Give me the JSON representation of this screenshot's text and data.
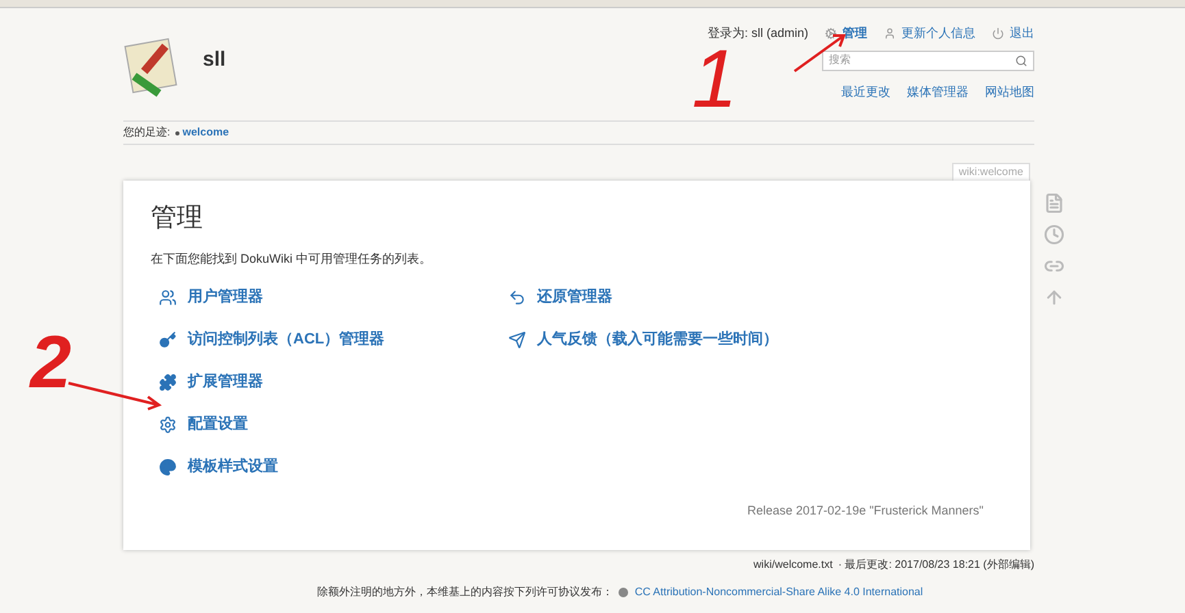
{
  "user_bar": {
    "logged_in_as": "登录为: sll (admin)",
    "links": [
      {
        "kind": "admin",
        "label": "管理",
        "selected": true
      },
      {
        "kind": "profile",
        "label": "更新个人信息",
        "selected": false
      },
      {
        "kind": "logout",
        "label": "退出",
        "selected": false
      }
    ]
  },
  "site": {
    "title": "sll"
  },
  "search": {
    "placeholder": "搜索"
  },
  "site_tools": [
    "最近更改",
    "媒体管理器",
    "网站地图"
  ],
  "breadcrumbs": {
    "label": "您的足迹:",
    "items": [
      "welcome"
    ]
  },
  "page": {
    "id": "wiki:welcome",
    "title": "管理",
    "intro": "在下面您能找到 DokuWiki 中可用管理任务的列表。",
    "columns": [
      [
        {
          "kind": "users",
          "label": "用户管理器"
        },
        {
          "kind": "acl",
          "label": "访问控制列表（ACL）管理器"
        },
        {
          "kind": "extension",
          "label": "扩展管理器"
        },
        {
          "kind": "config",
          "label": "配置设置"
        },
        {
          "kind": "style",
          "label": "模板样式设置"
        }
      ],
      [
        {
          "kind": "revert",
          "label": "还原管理器"
        },
        {
          "kind": "popularity",
          "label": "人气反馈（载入可能需要一些时间）"
        }
      ]
    ],
    "version": "Release 2017-02-19e \"Frusterick Manners\""
  },
  "page_tools": [
    {
      "kind": "source"
    },
    {
      "kind": "revisions"
    },
    {
      "kind": "backlinks"
    },
    {
      "kind": "top"
    }
  ],
  "doc_info": {
    "file": "wiki/welcome.txt",
    "modified": "· 最后更改: 2017/08/23 18:21 (外部编辑)"
  },
  "license": {
    "text": "除额外注明的地方外，本维基上的内容按下列许可协议发布：",
    "link": "CC Attribution-Noncommercial-Share Alike 4.0 International"
  },
  "annotations": [
    {
      "kind": "arrow"
    },
    {
      "kind": "digit",
      "label": "1"
    },
    {
      "kind": "digit",
      "label": "2"
    },
    {
      "kind": "arrow"
    }
  ]
}
